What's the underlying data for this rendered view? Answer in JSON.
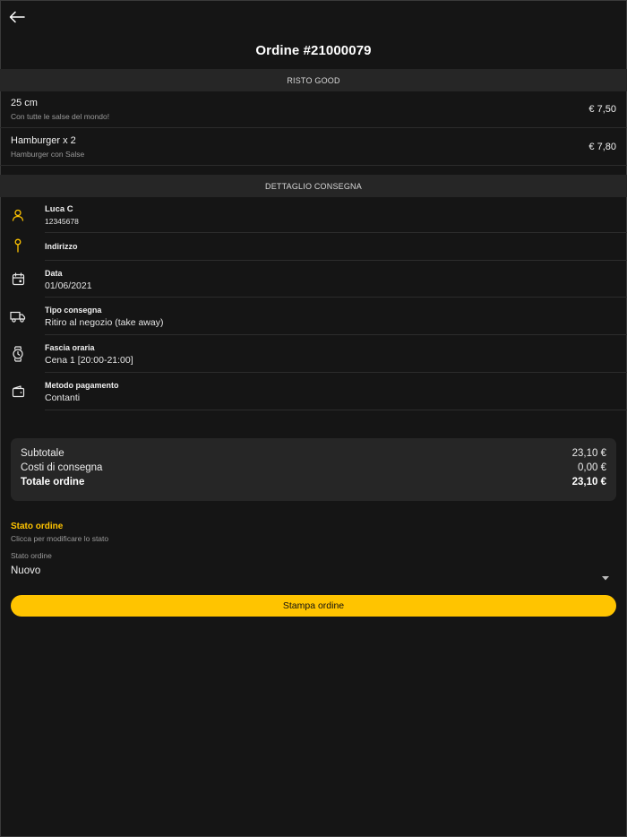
{
  "header": {
    "title": "Ordine #21000079"
  },
  "icons": {
    "back": "arrow-left-icon"
  },
  "restaurant": {
    "name": "RISTO GOOD",
    "items": [
      {
        "name": "25 cm",
        "description": "Con tutte le salse del mondo!",
        "price": "€ 7,50"
      },
      {
        "name": "Hamburger x 2",
        "description": "Hamburger con Salse",
        "price": "€ 7,80"
      }
    ]
  },
  "delivery": {
    "header": "DETTAGLIO CONSEGNA",
    "customer": {
      "name": "Luca C",
      "phone": "12345678",
      "icon": "user-icon"
    },
    "address": {
      "label": "Indirizzo",
      "icon": "pin-icon"
    },
    "date": {
      "label": "Data",
      "value": "01/06/2021",
      "icon": "calendar-icon"
    },
    "type": {
      "label": "Tipo consegna",
      "value": "Ritiro al negozio (take away)",
      "icon": "truck-icon"
    },
    "slot": {
      "label": "Fascia oraria",
      "value": "Cena 1 [20:00-21:00]",
      "icon": "watch-icon"
    },
    "payment": {
      "label": "Metodo pagamento",
      "value": "Contanti",
      "icon": "wallet-icon"
    }
  },
  "summary": {
    "subtotal_label": "Subtotale",
    "subtotal_value": "23,10 €",
    "delivery_label": "Costi di consegna",
    "delivery_value": "0,00 €",
    "total_label": "Totale ordine",
    "total_value": "23,10 €"
  },
  "status": {
    "title": "Stato ordine",
    "subtitle": "Clicca per modificare lo stato",
    "select_label": "Stato ordine",
    "select_value": "Nuovo"
  },
  "actions": {
    "print_label": "Stampa ordine"
  },
  "colors": {
    "background": "#151515",
    "section": "#262626",
    "accent": "#ffc400"
  }
}
